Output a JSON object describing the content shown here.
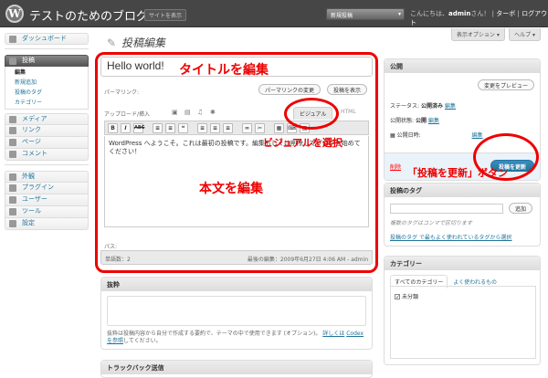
{
  "header": {
    "site_title": "テストのためのブログ",
    "site_button": "サイトを表示",
    "new_post": "新規投稿",
    "greeting": "こんにちは、",
    "username": "admin",
    "greeting_suffix": "さん！",
    "turbo": "ターボ",
    "logout": "ログアウト",
    "sep": "|"
  },
  "screen_tabs": [
    "表示オプション ▾",
    "ヘルプ ▾"
  ],
  "sidebar": {
    "dashboard": "ダッシュボード",
    "posts": "投稿",
    "posts_sub": [
      "編集",
      "新規追加",
      "投稿のタグ",
      "カテゴリー"
    ],
    "group1": [
      "メディア",
      "リンク",
      "ページ",
      "コメント"
    ],
    "group2": [
      "外観",
      "プラグイン",
      "ユーザー",
      "ツール",
      "設定"
    ]
  },
  "page": {
    "title": "投稿編集"
  },
  "editor": {
    "post_title": "Hello world!",
    "permalink_label": "パーマリンク:",
    "permalink_change": "パーマリンクの変更",
    "permalink_view": "投稿を表示",
    "upload_label": "アップロード/挿入",
    "visual_tab": "ビジュアル",
    "html_tab": "HTML",
    "toolbar": [
      "B",
      "I",
      "ABC",
      "≡",
      "≡",
      "❝",
      "≡",
      "≡",
      "≡",
      "∞",
      "✂",
      "▦",
      "⌨",
      "▤"
    ],
    "content": "WordPress へようこそ。これは最初の投稿です。編集もしくは削除してブログを始めてください！",
    "path_label": "パス:",
    "word_count": "単語数：2",
    "last_edit": "最後の編集：2009年6月27日 4:06 AM - admin"
  },
  "excerpt": {
    "title": "抜粋",
    "note": "抜粋は投稿内容から自分で作成する要約で、テーマの中で使用できます (オプション)。",
    "link1": "詳しくは",
    "link2": "Codex を参照",
    "note_end": "してください。"
  },
  "trackback": {
    "title": "トラックバック送信"
  },
  "publish": {
    "title": "公開",
    "preview": "変更をプレビュー",
    "status_label": "ステータス:",
    "status_value": "公開済み",
    "visibility_label": "公開状態:",
    "visibility_value": "公開",
    "date_label": "公開日時:",
    "edit": "編集",
    "delete": "削除",
    "update": "投稿を更新"
  },
  "tags": {
    "title": "投稿のタグ",
    "add": "追加",
    "note": "複数のタグはコンマで区切ります",
    "link": "投稿のタグ で最もよく使われているタグから選択"
  },
  "categories": {
    "title": "カテゴリー",
    "tab_all": "すべてのカテゴリー",
    "tab_popular": "よく使われるもの",
    "items": [
      "未分類"
    ]
  },
  "annotations": {
    "title_edit": "タイトルを編集",
    "visual_select": "ビジュアルを選択",
    "body_edit": "本文を編集",
    "update_label": "「投稿を更新」ボタン"
  },
  "colors": {
    "accent": "#21759b",
    "annotation": "#e00000",
    "header_bg": "#464646"
  }
}
